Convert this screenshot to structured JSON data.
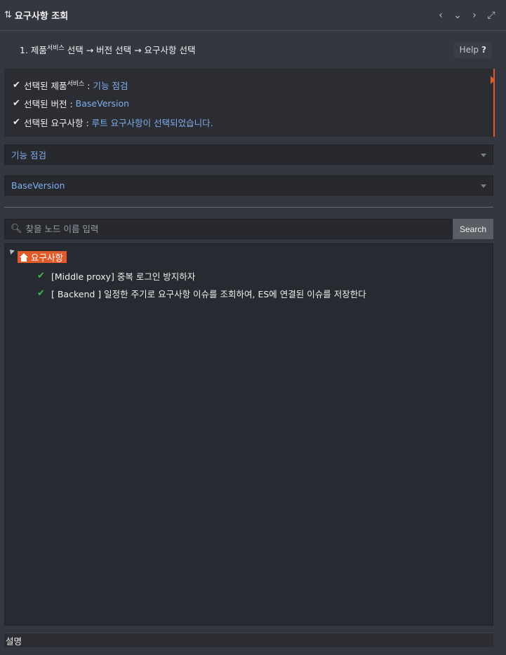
{
  "header": {
    "title": "요구사항 조회",
    "title_icon": "sort-list-icon",
    "controls": [
      "chevron-left-icon",
      "chevron-down-icon",
      "chevron-right-icon",
      "expand-icon"
    ]
  },
  "steps": {
    "text_prefix": "1. 제품",
    "text_sup": "서비스",
    "text_suffix": " 선택 → 버전 선택 → 요구사항 선택",
    "help_label": "Help",
    "help_icon": "?"
  },
  "selection": {
    "product_label_prefix": "선택된 제품",
    "product_label_sup": "서비스",
    "product_label_suffix": " :",
    "product_value": "기능 점검",
    "version_label": "선택된 버전 :",
    "version_value": "BaseVersion",
    "requirement_label": "선택된 요구사항 :",
    "requirement_value": "루트 요구사항이 선택되었습니다."
  },
  "product_select": {
    "value": "기능 점검"
  },
  "version_select": {
    "value": "BaseVersion"
  },
  "search": {
    "placeholder": "찾을 노드 이름 입력",
    "button_label": "Search"
  },
  "tree": {
    "root_label": "요구사항",
    "children": [
      {
        "label": "[Middle proxy] 중복 로그인 방지하자"
      },
      {
        "label": "[ Backend ] 일정한 주기로 요구사항 이슈를 조회하여, ES에 연결된 이슈를 저장한다"
      }
    ]
  },
  "description": {
    "label": "설명"
  },
  "colors": {
    "accent": "#e05a2a",
    "link": "#7fb0ee",
    "check_green": "#3bbf4a"
  }
}
